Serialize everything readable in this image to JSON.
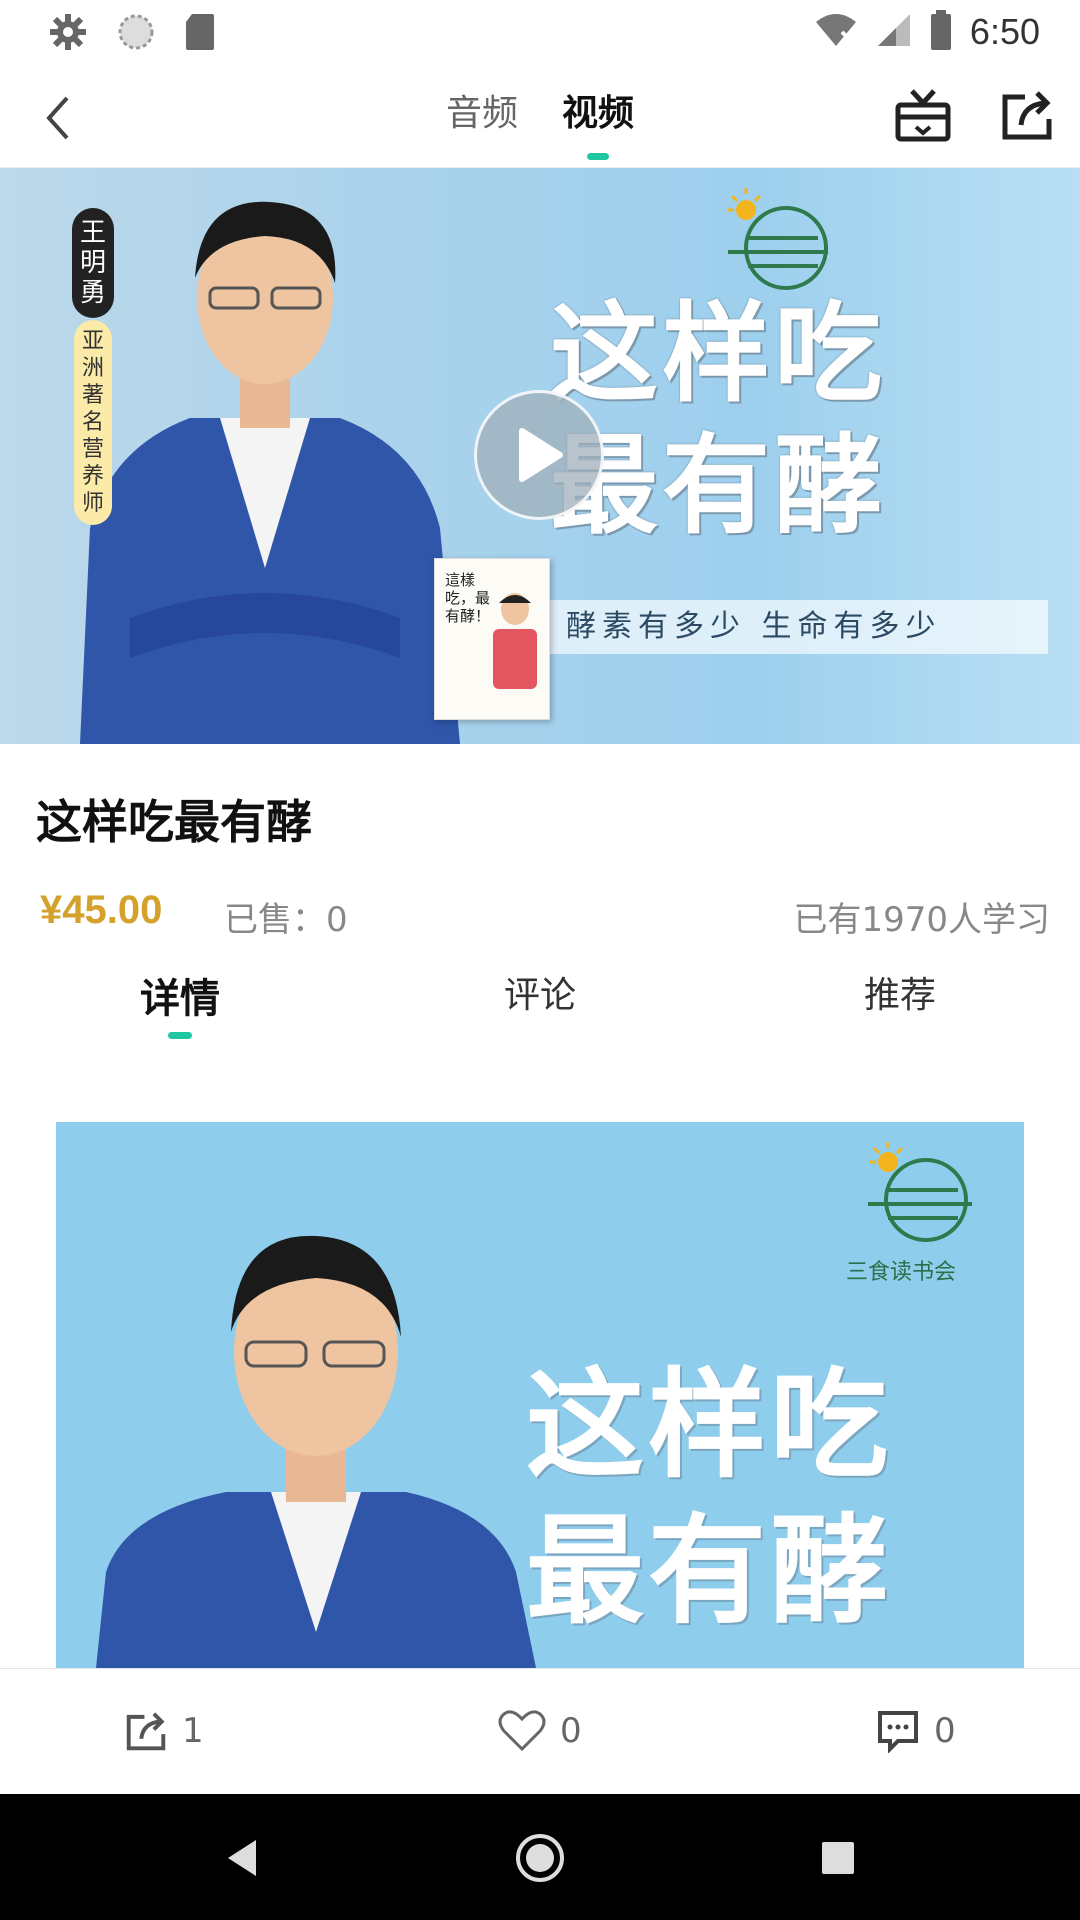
{
  "status_bar": {
    "time": "6:50",
    "icons": [
      "settings-icon",
      "sync-icon",
      "sd-card-icon",
      "wifi-off-icon",
      "signal-icon",
      "battery-icon"
    ]
  },
  "top_nav": {
    "tabs": [
      {
        "label": "音频",
        "active": false
      },
      {
        "label": "视频",
        "active": true
      }
    ],
    "icons": [
      "back-icon",
      "gift-icon",
      "share-icon"
    ]
  },
  "hero": {
    "presenter_name": "王明勇",
    "presenter_title": "亚洲著名营养师",
    "title_line1": "这样吃",
    "title_line2": "最有酵",
    "subtitle": "酵素有多少 生命有多少",
    "book_title": "這樣吃，最有酵！"
  },
  "product": {
    "title": "这样吃最有酵",
    "price": "¥45.00",
    "sold": "已售：0",
    "learners": "已有1970人学习"
  },
  "detail_tabs": [
    {
      "label": "详情",
      "active": true
    },
    {
      "label": "评论",
      "active": false
    },
    {
      "label": "推荐",
      "active": false
    }
  ],
  "content_image": {
    "logo_text": "三食读书会",
    "title_line1": "这样吃",
    "title_line2": "最有酵"
  },
  "action_bar": {
    "share_count": "1",
    "like_count": "0",
    "comment_count": "0"
  },
  "colors": {
    "accent": "#1fc7a0",
    "price": "#d4a12a",
    "hero_bg": "#a9d2ec"
  }
}
